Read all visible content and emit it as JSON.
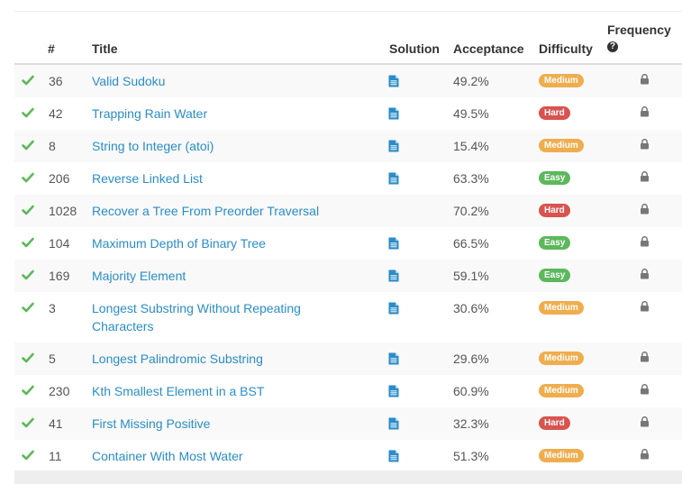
{
  "header": {
    "num": "#",
    "title": "Title",
    "solution": "Solution",
    "acceptance": "Acceptance",
    "difficulty": "Difficulty",
    "frequency": "Frequency",
    "frequency_icon": "question-circle-icon"
  },
  "colors": {
    "link": "#2a8dc8",
    "check": "#5cb85c",
    "Easy": "#5cb85c",
    "Medium": "#f0ad4e",
    "Hard": "#d9534f",
    "solution_icon": "#2a8dc8",
    "lock": "#777777"
  },
  "rows": [
    {
      "id": "36",
      "title": "Valid Sudoku",
      "solution": true,
      "acceptance": "49.2%",
      "difficulty": "Medium"
    },
    {
      "id": "42",
      "title": "Trapping Rain Water",
      "solution": true,
      "acceptance": "49.5%",
      "difficulty": "Hard"
    },
    {
      "id": "8",
      "title": "String to Integer (atoi)",
      "solution": true,
      "acceptance": "15.4%",
      "difficulty": "Medium"
    },
    {
      "id": "206",
      "title": "Reverse Linked List",
      "solution": true,
      "acceptance": "63.3%",
      "difficulty": "Easy"
    },
    {
      "id": "1028",
      "title": "Recover a Tree From Preorder Traversal",
      "solution": false,
      "acceptance": "70.2%",
      "difficulty": "Hard"
    },
    {
      "id": "104",
      "title": "Maximum Depth of Binary Tree",
      "solution": true,
      "acceptance": "66.5%",
      "difficulty": "Easy"
    },
    {
      "id": "169",
      "title": "Majority Element",
      "solution": true,
      "acceptance": "59.1%",
      "difficulty": "Easy"
    },
    {
      "id": "3",
      "title": "Longest Substring Without Repeating Characters",
      "solution": true,
      "acceptance": "30.6%",
      "difficulty": "Medium"
    },
    {
      "id": "5",
      "title": "Longest Palindromic Substring",
      "solution": true,
      "acceptance": "29.6%",
      "difficulty": "Medium"
    },
    {
      "id": "230",
      "title": "Kth Smallest Element in a BST",
      "solution": true,
      "acceptance": "60.9%",
      "difficulty": "Medium"
    },
    {
      "id": "41",
      "title": "First Missing Positive",
      "solution": true,
      "acceptance": "32.3%",
      "difficulty": "Hard"
    },
    {
      "id": "11",
      "title": "Container With Most Water",
      "solution": true,
      "acceptance": "51.3%",
      "difficulty": "Medium"
    }
  ]
}
